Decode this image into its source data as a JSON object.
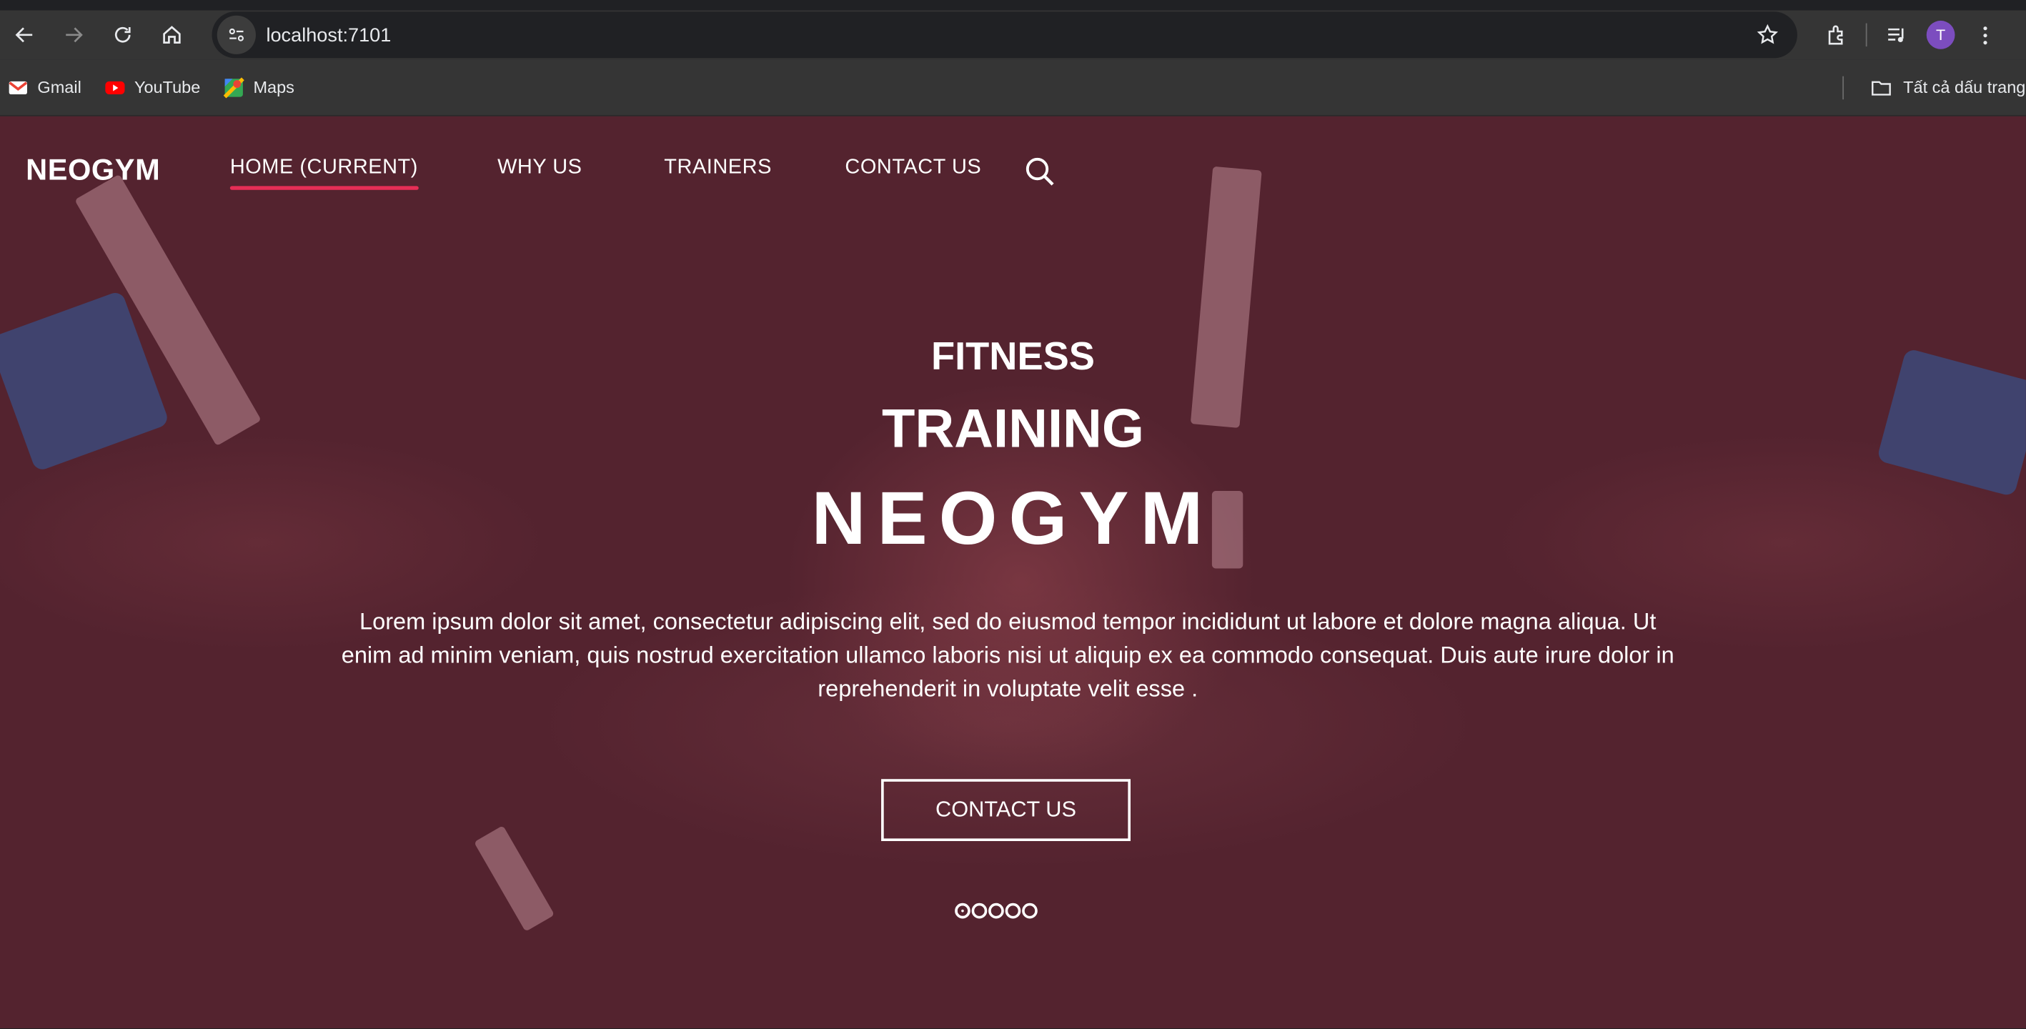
{
  "browser": {
    "url": "localhost:7101",
    "profile_initial": "T",
    "bookmarks": [
      {
        "label": "Gmail",
        "icon": "gmail-icon"
      },
      {
        "label": "YouTube",
        "icon": "youtube-icon"
      },
      {
        "label": "Maps",
        "icon": "maps-icon"
      }
    ],
    "all_bookmarks_label": "Tất cả dấu trang"
  },
  "site": {
    "brand": "NEOGYM",
    "nav": {
      "home": "HOME (CURRENT)",
      "why_us": "WHY US",
      "trainers": "TRAINERS",
      "contact": "CONTACT US"
    },
    "hero": {
      "line1": "FITNESS",
      "line2": "TRAINING",
      "line3": "NEOGYM",
      "description": "Lorem ipsum dolor sit amet, consectetur adipiscing elit, sed do eiusmod tempor incididunt ut labore et dolore magna aliqua. Ut enim ad minim veniam, quis nostrud exercitation ullamco laboris nisi ut aliquip ex ea commodo consequat. Duis aute irure dolor in reprehenderit in voluptate velit esse .",
      "cta": "CONTACT US"
    },
    "carousel": {
      "slides": 5,
      "active": 1
    },
    "colors": {
      "overlay": "#54232f",
      "accent": "#e62e56"
    }
  }
}
